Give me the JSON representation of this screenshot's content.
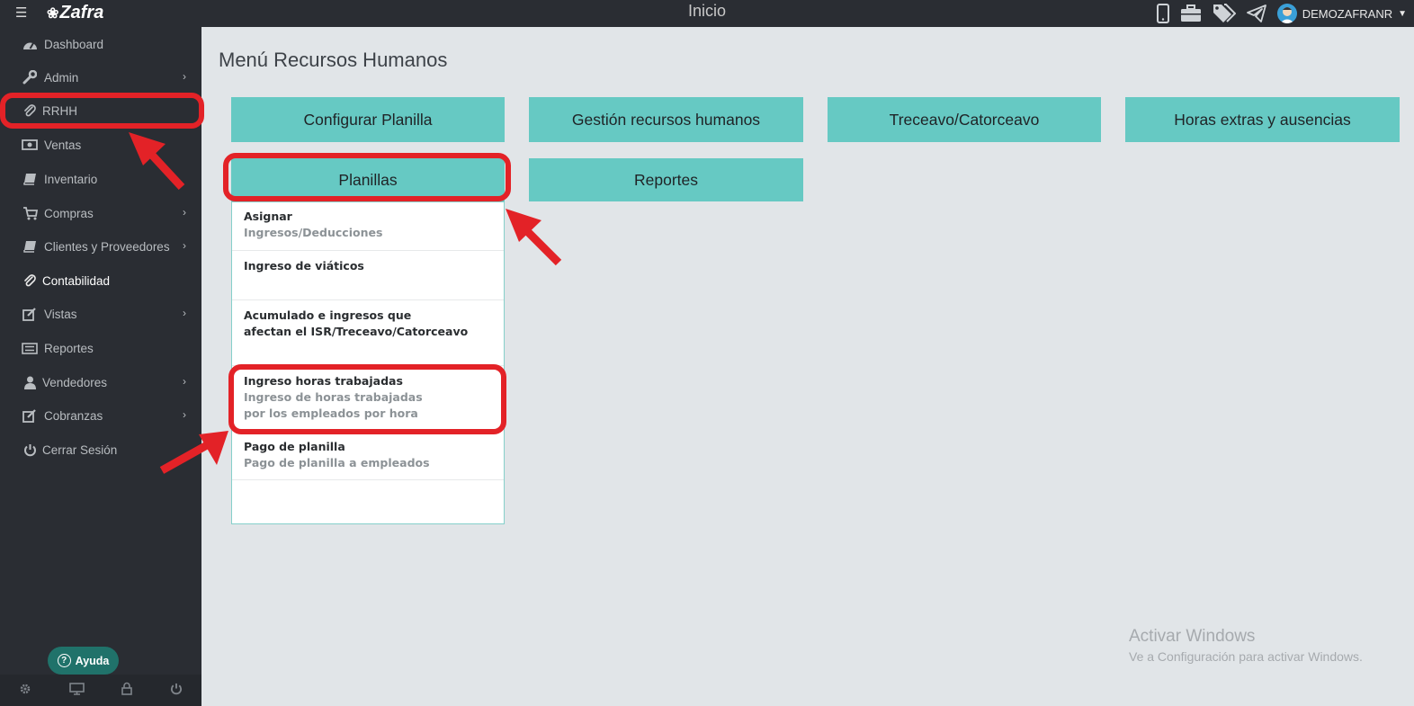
{
  "topbar": {
    "title": "Inicio",
    "brand": "Zafra",
    "user": "DEMOZAFRANR",
    "icons": [
      "menu-icon",
      "mobile-icon",
      "briefcase-icon",
      "tags-icon",
      "paper-plane-icon",
      "user-avatar",
      "chevron-down-icon"
    ]
  },
  "sidebar": {
    "items": [
      {
        "label": "Dashboard",
        "icon": "dashboard-icon"
      },
      {
        "label": "Admin",
        "icon": "wrench-icon"
      },
      {
        "label": "RRHH",
        "icon": "paperclip-icon"
      },
      {
        "label": "Ventas",
        "icon": "money-icon"
      },
      {
        "label": "Inventario",
        "icon": "book-icon"
      },
      {
        "label": "Compras",
        "icon": "cart-icon"
      },
      {
        "label": "Clientes y Proveedores",
        "icon": "book-icon"
      },
      {
        "label": "Contabilidad",
        "icon": "paperclip-icon"
      },
      {
        "label": "Vistas",
        "icon": "edit-icon"
      },
      {
        "label": "Reportes",
        "icon": "list-icon"
      },
      {
        "label": "Vendedores",
        "icon": "user-icon"
      },
      {
        "label": "Cobranzas",
        "icon": "edit-icon"
      },
      {
        "label": "Cerrar Sesión",
        "icon": "power-icon"
      }
    ],
    "help_label": "Ayuda",
    "footer_icons": [
      "gear-icon",
      "monitor-icon",
      "lock-icon",
      "power-icon"
    ]
  },
  "main": {
    "title": "Menú Recursos Humanos",
    "tiles": [
      "Configurar Planilla",
      "Gestión recursos humanos",
      "Treceavo/Catorceavo",
      "Horas extras y ausencias",
      "Planillas",
      "Reportes"
    ],
    "dropdown": [
      {
        "title": "Asignar",
        "sub": [
          "Ingresos/Deducciones"
        ]
      },
      {
        "title": "Ingreso de viáticos",
        "sub": []
      },
      {
        "title": "Acumulado e ingresos que",
        "title2": "afectan el ISR/Treceavo/Catorceavo",
        "sub": []
      },
      {
        "title": "Ingreso horas trabajadas",
        "sub": [
          "Ingreso de horas trabajadas",
          "por los empleados por hora"
        ]
      },
      {
        "title": "Pago de planilla",
        "sub": [
          "Pago de planilla a empleados"
        ]
      }
    ]
  },
  "watermark": {
    "line1": "Activar Windows",
    "line2": "Ve a Configuración para activar Windows."
  },
  "colors": {
    "sidebar": "#2a2d33",
    "tile": "#66c9c3",
    "background": "#e1e5e8",
    "annotation": "#e32227"
  }
}
